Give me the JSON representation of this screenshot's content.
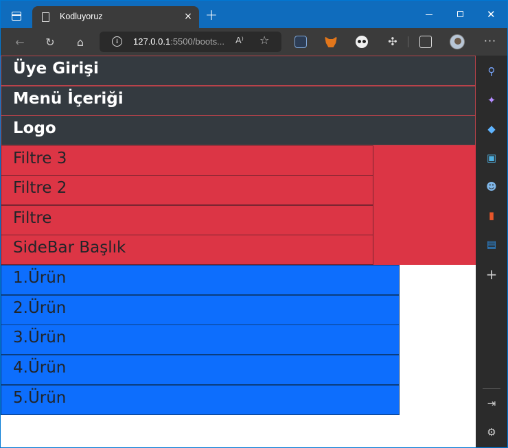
{
  "browser": {
    "tab_title": "Kodluyoruz",
    "tab_close": "×",
    "new_tab": "+",
    "url_host": "127.0.0.1",
    "url_rest": ":5500/boots...",
    "read_aloud": "A⁾",
    "menu": "···"
  },
  "page": {
    "nav_items": [
      "Üye Girişi",
      "Menü İçeriği",
      "Logo"
    ],
    "filters": [
      "Filtre 3",
      "Filtre 2",
      "Filtre",
      "SideBar Başlık"
    ],
    "products": [
      "1.Ürün",
      "2.Ürün",
      "3.Ürün",
      "4.Ürün",
      "5.Ürün"
    ]
  },
  "colors": {
    "nav_bg": "#343a40",
    "red_bg": "#dc3545",
    "blue_bg": "#0d6efd",
    "titlebar": "#0f6cbd"
  },
  "icons": {
    "side_panel": [
      "search-icon",
      "copilot-icon",
      "shopping-tag-icon",
      "tools-icon",
      "games-icon",
      "office-icon",
      "outlook-icon",
      "add-icon",
      "hide-sidebar-icon",
      "settings-icon"
    ]
  }
}
